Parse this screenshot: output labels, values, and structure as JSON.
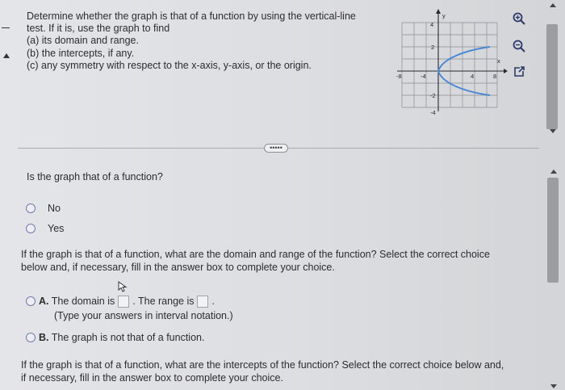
{
  "question": {
    "line1": "Determine whether the graph is that of a function by using the vertical-line",
    "line2": "test. If it is, use the graph to find",
    "line3": "(a) its domain and range.",
    "line4": "(b) the intercepts, if any.",
    "line5": "(c) any symmetry with respect to the x-axis, y-axis, or the origin."
  },
  "graph": {
    "x_axis_label": "x",
    "y_axis_label": "y",
    "x_ticks": [
      "-8",
      "-4",
      "4",
      "8"
    ],
    "y_ticks": [
      "4",
      "2",
      "-2",
      "-4"
    ],
    "curve_color": "#4a88d6"
  },
  "tools": [
    "zoom-in-icon",
    "zoom-out-icon",
    "pop-out-icon"
  ],
  "ellipsis_label": "•••••",
  "part1": {
    "prompt": "Is the graph that of a function?",
    "options": [
      "No",
      "Yes"
    ]
  },
  "part2": {
    "prompt_line1": "If the graph is that of a function, what are the domain and range of the function? Select the correct choice",
    "prompt_line2": "below and, if necessary, fill in the answer box to complete your choice.",
    "option_a_letter": "A.",
    "option_a_text1": "The domain is",
    "option_a_text2": ". The range is",
    "option_a_text3": ".",
    "option_a_hint": "(Type your answers in interval notation.)",
    "option_b_letter": "B.",
    "option_b_text": "The graph is not that of a function."
  },
  "part3": {
    "prompt_line1": "If the graph is that of a function, what are the intercepts of the function? Select the correct choice below and,",
    "prompt_line2": "if necessary, fill in the answer box to complete your choice."
  }
}
